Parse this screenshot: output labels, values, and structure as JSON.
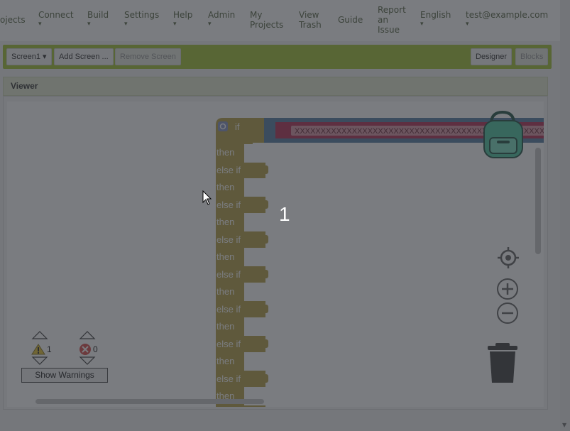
{
  "nav": {
    "items": [
      {
        "label": "ojects",
        "caret": ""
      },
      {
        "label": "Connect",
        "caret": "▾"
      },
      {
        "label": "Build",
        "caret": "▾"
      },
      {
        "label": "Settings",
        "caret": "▾"
      },
      {
        "label": "Help",
        "caret": "▾"
      },
      {
        "label": "Admin",
        "caret": "▾"
      },
      {
        "label": "My Projects",
        "caret": ""
      },
      {
        "label": "View Trash",
        "caret": ""
      },
      {
        "label": "Guide",
        "caret": ""
      },
      {
        "label": "Report an Issue",
        "caret": ""
      },
      {
        "label": "English",
        "caret": "▾"
      },
      {
        "label": "test@example.com",
        "caret": "▾"
      }
    ]
  },
  "toolbar": {
    "screen_select": "Screen1 ▾",
    "add_screen": "Add Screen ...",
    "remove_screen": "Remove Screen",
    "designer": "Designer",
    "blocks": "Blocks"
  },
  "viewer": {
    "title": "Viewer"
  },
  "blocks": {
    "if_label": "if",
    "then_label": "then",
    "else_if_label": "else if",
    "string_value": "XXXXXXXXXXXXXXXXXXXXXXXXXXXXXXXXXXXXXXXXXXXXXXXXXXXXXX",
    "rows": [
      "then",
      "else if",
      "then",
      "else if",
      "then",
      "else if",
      "then",
      "else if",
      "then",
      "else if",
      "then",
      "else if",
      "then",
      "else if",
      "then"
    ]
  },
  "page_number": "1",
  "warnings": {
    "warning_count": "1",
    "error_count": "0",
    "show_warnings_label": "Show Warnings"
  },
  "colors": {
    "accent_green": "#a6c43c",
    "control_block": "#b8a44c",
    "text_block": "#b6365a",
    "logic_block": "#5b80a5",
    "backpack": "#53c7a3"
  }
}
